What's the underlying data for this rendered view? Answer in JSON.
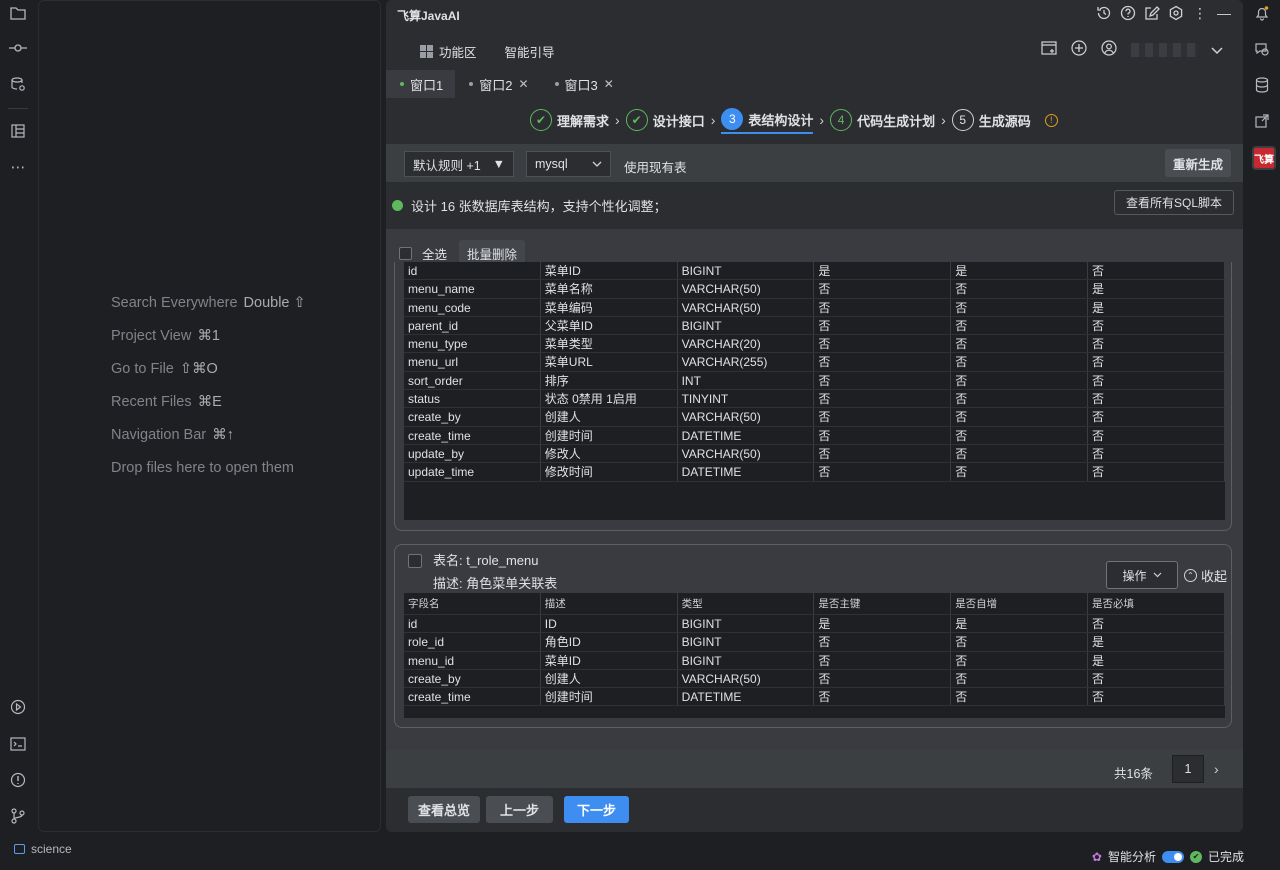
{
  "app": {
    "title": "飞算JavaAI",
    "badge": "飞算"
  },
  "nav": {
    "feature_area": "功能区",
    "smart_guide": "智能引导"
  },
  "tabs": [
    {
      "label": "窗口1"
    },
    {
      "label": "窗口2"
    },
    {
      "label": "窗口3"
    }
  ],
  "steps": [
    {
      "label": "理解需求",
      "mark": "✔"
    },
    {
      "label": "设计接口",
      "mark": "✔"
    },
    {
      "label": "表结构设计",
      "mark": "3"
    },
    {
      "label": "代码生成计划",
      "mark": "4"
    },
    {
      "label": "生成源码",
      "mark": "5"
    }
  ],
  "toolbar": {
    "rule_select": "默认规则 +1",
    "db_select": "mysql",
    "use_existing": "使用现有表",
    "regenerate": "重新生成"
  },
  "status": {
    "message": "设计 16 张数据库表结构，支持个性化调整；",
    "view_sql": "查看所有SQL脚本"
  },
  "selection": {
    "select_all": "全选",
    "batch_delete": "批量删除"
  },
  "hints": {
    "search": "Search Everywhere",
    "search_key": "Double ⇧",
    "project": "Project View",
    "project_key": "⌘1",
    "goto": "Go to File",
    "goto_key": "⇧⌘O",
    "recent": "Recent Files",
    "recent_key": "⌘E",
    "navbar": "Navigation Bar",
    "navbar_key": "⌘↑",
    "drop": "Drop files here to open them"
  },
  "table1": {
    "rows": [
      [
        "id",
        "菜单ID",
        "BIGINT",
        "是",
        "是",
        "否"
      ],
      [
        "menu_name",
        "菜单名称",
        "VARCHAR(50)",
        "否",
        "否",
        "是"
      ],
      [
        "menu_code",
        "菜单编码",
        "VARCHAR(50)",
        "否",
        "否",
        "是"
      ],
      [
        "parent_id",
        "父菜单ID",
        "BIGINT",
        "否",
        "否",
        "否"
      ],
      [
        "menu_type",
        "菜单类型",
        "VARCHAR(20)",
        "否",
        "否",
        "否"
      ],
      [
        "menu_url",
        "菜单URL",
        "VARCHAR(255)",
        "否",
        "否",
        "否"
      ],
      [
        "sort_order",
        "排序",
        "INT",
        "否",
        "否",
        "否"
      ],
      [
        "status",
        "状态 0禁用 1启用",
        "TINYINT",
        "否",
        "否",
        "否"
      ],
      [
        "create_by",
        "创建人",
        "VARCHAR(50)",
        "否",
        "否",
        "否"
      ],
      [
        "create_time",
        "创建时间",
        "DATETIME",
        "否",
        "否",
        "否"
      ],
      [
        "update_by",
        "修改人",
        "VARCHAR(50)",
        "否",
        "否",
        "否"
      ],
      [
        "update_time",
        "修改时间",
        "DATETIME",
        "否",
        "否",
        "否"
      ]
    ]
  },
  "table2": {
    "name": "表名: t_role_menu",
    "desc": "描述: 角色菜单关联表",
    "operate": "操作",
    "collapse": "收起",
    "headers": [
      "字段名",
      "描述",
      "类型",
      "是否主键",
      "是否自增",
      "是否必填"
    ],
    "rows": [
      [
        "id",
        "ID",
        "BIGINT",
        "是",
        "是",
        "否"
      ],
      [
        "role_id",
        "角色ID",
        "BIGINT",
        "否",
        "否",
        "是"
      ],
      [
        "menu_id",
        "菜单ID",
        "BIGINT",
        "否",
        "否",
        "是"
      ],
      [
        "create_by",
        "创建人",
        "VARCHAR(50)",
        "否",
        "否",
        "否"
      ],
      [
        "create_time",
        "创建时间",
        "DATETIME",
        "否",
        "否",
        "否"
      ]
    ]
  },
  "pager": {
    "total": "共16条",
    "page": "1"
  },
  "footer": {
    "overview": "查看总览",
    "prev": "上一步",
    "next": "下一步"
  },
  "statusbar": {
    "project": "science",
    "smart_analysis": "智能分析",
    "done": "已完成"
  },
  "colors": {
    "accent": "#3d8ef0",
    "success": "#5fb85f",
    "warning": "#e0a020",
    "brand": "#c8282f"
  }
}
